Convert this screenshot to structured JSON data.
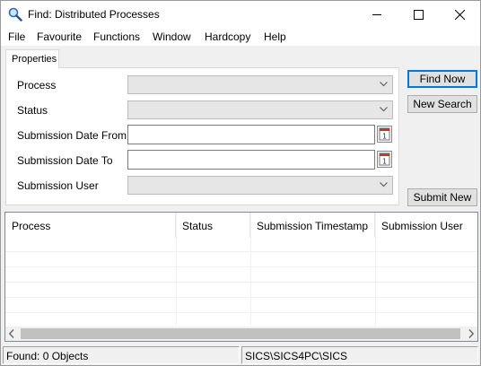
{
  "window": {
    "title": "Find: Distributed Processes"
  },
  "menu": [
    "File",
    "Favourite",
    "Functions",
    "Window",
    "Hardcopy",
    "Help"
  ],
  "tabs": {
    "properties": "Properties"
  },
  "form": {
    "process_label": "Process",
    "status_label": "Status",
    "date_from_label": "Submission Date From",
    "date_to_label": "Submission Date To",
    "user_label": "Submission User",
    "process_value": "",
    "status_value": "",
    "date_from_value": "",
    "date_to_value": "",
    "user_value": ""
  },
  "buttons": {
    "find_now": "Find Now",
    "new_search": "New Search",
    "submit_new": "Submit New"
  },
  "table": {
    "columns": [
      "Process",
      "Status",
      "Submission Timestamp",
      "Submission User"
    ],
    "rows": []
  },
  "status": {
    "found": "Found: 0 Objects",
    "path": "SICS\\SICS4PC\\SICS"
  },
  "icons": {
    "app": "magnifier-icon",
    "calendar": "calendar-icon"
  }
}
